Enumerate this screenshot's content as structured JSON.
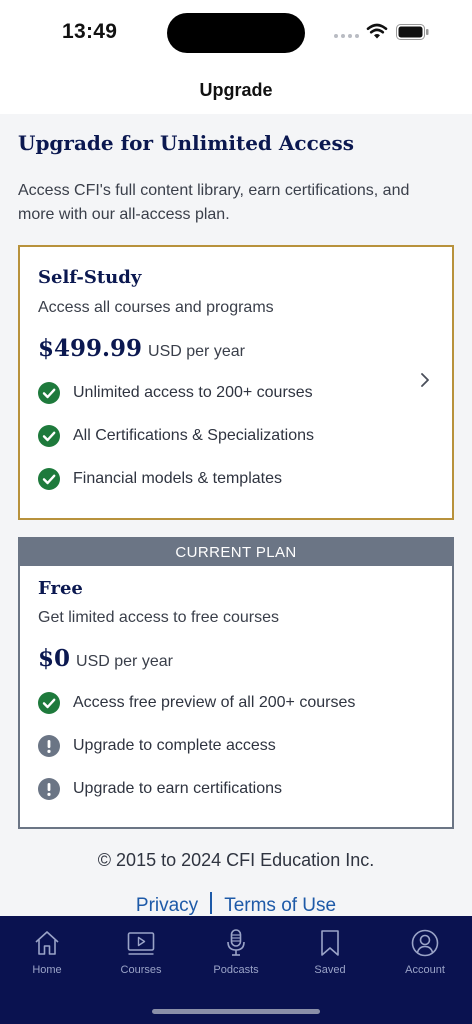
{
  "status_bar": {
    "time": "13:49"
  },
  "nav": {
    "title": "Upgrade"
  },
  "page": {
    "title": "Upgrade for Unlimited Access",
    "intro": "Access CFI's full content library, earn certifications, and more with our all-access plan."
  },
  "plans": [
    {
      "name": "Self-Study",
      "description": "Access all courses and programs",
      "price": "$499.99",
      "period": "USD per year",
      "features": [
        {
          "text": "Unlimited access to 200+ courses",
          "icon": "check-circle-icon"
        },
        {
          "text": "All Certifications & Specializations",
          "icon": "check-circle-icon"
        },
        {
          "text": "Financial models & templates",
          "icon": "check-circle-icon"
        }
      ]
    },
    {
      "banner": "CURRENT PLAN",
      "name": "Free",
      "description": "Get limited access to free courses",
      "price": "$0",
      "period": "USD per year",
      "features": [
        {
          "text": "Access free preview of all 200+ courses",
          "icon": "check-circle-icon"
        },
        {
          "text": "Upgrade to complete access",
          "icon": "exclamation-circle-icon"
        },
        {
          "text": "Upgrade to earn certifications",
          "icon": "exclamation-circle-icon"
        }
      ]
    }
  ],
  "footer": {
    "copyright": "© 2015 to 2024 CFI Education Inc.",
    "privacy": "Privacy",
    "terms": "Terms of Use"
  },
  "tabs": [
    {
      "label": "Home",
      "icon": "home-icon"
    },
    {
      "label": "Courses",
      "icon": "courses-icon"
    },
    {
      "label": "Podcasts",
      "icon": "microphone-icon"
    },
    {
      "label": "Saved",
      "icon": "bookmark-icon"
    },
    {
      "label": "Account",
      "icon": "account-icon"
    }
  ],
  "colors": {
    "brand_navy": "#0b1850",
    "tab_bar": "#0a1250",
    "selected_border": "#b8923c",
    "current_plan": "#6b7585",
    "check_green": "#1e7a3c",
    "warning_gray": "#6b7585",
    "link_blue": "#1e5aa8"
  }
}
